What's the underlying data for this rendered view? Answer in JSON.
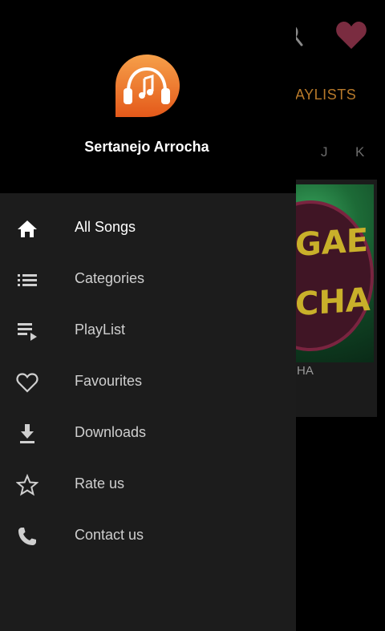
{
  "app": {
    "name": "Sertanejo Arrocha"
  },
  "background": {
    "tab_partial": "AYLISTS",
    "index_letters": [
      "J",
      "K"
    ],
    "card_caption": "HA",
    "card_art_text_line1": "GAE",
    "card_art_text_line2": "CHA"
  },
  "menu": {
    "items": [
      {
        "label": "All Songs",
        "icon": "home-icon"
      },
      {
        "label": "Categories",
        "icon": "list-icon"
      },
      {
        "label": "PlayList",
        "icon": "playlist-icon"
      },
      {
        "label": "Favourites",
        "icon": "heart-outline-icon"
      },
      {
        "label": "Downloads",
        "icon": "download-icon"
      },
      {
        "label": "Rate us",
        "icon": "star-outline-icon"
      },
      {
        "label": "Contact us",
        "icon": "phone-icon"
      }
    ]
  },
  "colors": {
    "accent_orange": "#f07a22",
    "tab_gold": "#b7792a",
    "heart": "#7a2c40",
    "drawer_bg": "#1c1c1c"
  }
}
